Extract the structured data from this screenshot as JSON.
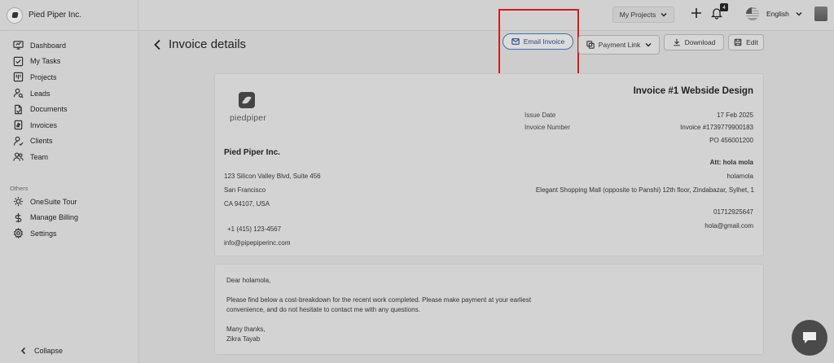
{
  "app": {
    "name": "Pied Piper Inc."
  },
  "sidebar": {
    "items": [
      {
        "label": "Dashboard",
        "icon": "dashboard-icon"
      },
      {
        "label": "My Tasks",
        "icon": "tasks-icon"
      },
      {
        "label": "Projects",
        "icon": "projects-icon"
      },
      {
        "label": "Leads",
        "icon": "leads-icon"
      },
      {
        "label": "Documents",
        "icon": "documents-icon"
      },
      {
        "label": "Invoices",
        "icon": "invoices-icon"
      },
      {
        "label": "Clients",
        "icon": "clients-icon"
      },
      {
        "label": "Team",
        "icon": "team-icon"
      }
    ],
    "others_label": "Others",
    "others": [
      {
        "label": "OneSuite Tour",
        "icon": "tour-icon"
      },
      {
        "label": "Manage Billing",
        "icon": "billing-icon"
      },
      {
        "label": "Settings",
        "icon": "settings-icon"
      }
    ],
    "collapse_label": "Collapse"
  },
  "topbar": {
    "project_select": "My Projects",
    "notification_count": "4",
    "language": "English"
  },
  "page": {
    "title": "Invoice details",
    "actions": {
      "email": "Email Invoice",
      "payment": "Payment Link",
      "download": "Download",
      "edit": "Edit"
    }
  },
  "invoice": {
    "logo_text": "piedpiper",
    "title": "Invoice #1 Webside Design",
    "sender": {
      "name": "Pied Piper Inc.",
      "address1": "123 Silicon Valley Blvd, Suite 456",
      "address2": "San Francisco",
      "address3": "CA 94107, USA",
      "phone": "+1 (415) 123-4567",
      "email": "info@pipepiperinc.com"
    },
    "issue_date_label": "Issue Date",
    "issue_date": "17 Feb 2025",
    "number_label": "Invoice Number",
    "number": "Invoice #1739779900183",
    "po": "PO 456001200",
    "recipient": {
      "att": "Att: hola mola",
      "name": "holamola",
      "address": "Elegant Shopping Mall (opposite to Panshi) 12th floor, Zindabazar, Sylhet, 1",
      "phone": "01712925647",
      "email": "hola@gmail.com"
    }
  },
  "message": {
    "greeting": "Dear holamola,",
    "line1": "Please find below a cost-breakdown for the recent work completed. Please make payment at your earliest",
    "line2": "convenience, and do not hesitate to contact me with any questions.",
    "closing": "Many thanks,",
    "signature": "Zikra Tayab"
  }
}
